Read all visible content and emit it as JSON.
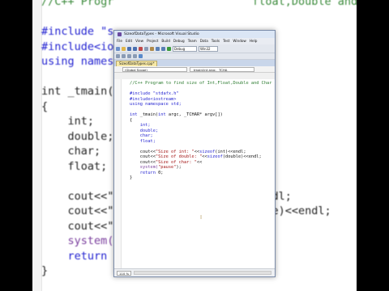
{
  "background_editor": {
    "lines": [
      {
        "parts": [
          {
            "t": "//C++ Progr",
            "c": "cm"
          },
          {
            "t": "                     ",
            "c": ""
          },
          {
            "t": "float,Double and cha",
            "c": "cm"
          }
        ]
      },
      {
        "parts": [
          {
            "t": "",
            "c": ""
          }
        ]
      },
      {
        "parts": [
          {
            "t": "#include \"s",
            "c": "kw"
          }
        ]
      },
      {
        "parts": [
          {
            "t": "#include<io",
            "c": "kw"
          }
        ]
      },
      {
        "parts": [
          {
            "t": "using names",
            "c": "kw"
          }
        ]
      },
      {
        "parts": [
          {
            "t": "",
            "c": ""
          }
        ]
      },
      {
        "parts": [
          {
            "t": "int _tmain(",
            "c": ""
          },
          {
            "t": "                     ",
            "c": ""
          },
          {
            "t": "[])",
            "c": ""
          }
        ]
      },
      {
        "parts": [
          {
            "t": "{",
            "c": ""
          }
        ]
      },
      {
        "parts": [
          {
            "t": "    int;",
            "c": ""
          }
        ]
      },
      {
        "parts": [
          {
            "t": "    double;",
            "c": ""
          }
        ]
      },
      {
        "parts": [
          {
            "t": "    char;",
            "c": ""
          }
        ]
      },
      {
        "parts": [
          {
            "t": "    float;",
            "c": ""
          }
        ]
      },
      {
        "parts": [
          {
            "t": "",
            "c": ""
          }
        ]
      },
      {
        "parts": [
          {
            "t": "    cout<<\"",
            "c": ""
          },
          {
            "t": "                  ",
            "c": ""
          },
          {
            "t": "t)<<endl;",
            "c": ""
          }
        ]
      },
      {
        "parts": [
          {
            "t": "    cout<<\"",
            "c": ""
          },
          {
            "t": "                  ",
            "c": ""
          },
          {
            "t": "(double)<<endl;",
            "c": ""
          }
        ]
      },
      {
        "parts": [
          {
            "t": "    cout<<\"",
            "c": ""
          }
        ]
      },
      {
        "parts": [
          {
            "t": "    system(",
            "c": "fn"
          }
        ]
      },
      {
        "parts": [
          {
            "t": "    return ",
            "c": "kw"
          }
        ]
      },
      {
        "parts": [
          {
            "t": "}",
            "c": ""
          }
        ]
      }
    ]
  },
  "window": {
    "title": "SizeofDataTypes - Microsoft Visual Studio",
    "menu": [
      "File",
      "Edit",
      "View",
      "Project",
      "Build",
      "Debug",
      "Team",
      "Data",
      "Tools",
      "Test",
      "Window",
      "Help"
    ],
    "config_select": "Debug",
    "platform_select": "Win32",
    "tab_label": "SizeofDataTypes.cpp*",
    "scope_select": "(Global Scope)",
    "function_select": "_tmain(int argc, _TCHA",
    "zoom_level": "110 %"
  },
  "code": [
    [
      {
        "t": "//C++ Program to find size of Int,Float,Double and Char",
        "c": "cm"
      }
    ],
    [
      {
        "t": "",
        "c": ""
      }
    ],
    [
      {
        "t": "#include \"stdafx.h\"",
        "c": "kw"
      }
    ],
    [
      {
        "t": "#include<iostream>",
        "c": "kw"
      }
    ],
    [
      {
        "t": "using namespace std;",
        "c": "kw"
      }
    ],
    [
      {
        "t": "",
        "c": ""
      }
    ],
    [
      {
        "t": "int",
        "c": "kw"
      },
      {
        "t": " _tmain(",
        "c": ""
      },
      {
        "t": "int",
        "c": "kw"
      },
      {
        "t": " argc, _TCHAR* argv[])",
        "c": ""
      }
    ],
    [
      {
        "t": "{",
        "c": ""
      }
    ],
    [
      {
        "t": "    int;",
        "c": "kw"
      }
    ],
    [
      {
        "t": "    double;",
        "c": "kw"
      }
    ],
    [
      {
        "t": "    char;",
        "c": "kw"
      }
    ],
    [
      {
        "t": "    float;",
        "c": "kw"
      }
    ],
    [
      {
        "t": "",
        "c": ""
      }
    ],
    [
      {
        "t": "    cout<<",
        "c": ""
      },
      {
        "t": "\"Size of int: \"",
        "c": "str"
      },
      {
        "t": "<<",
        "c": ""
      },
      {
        "t": "sizeof",
        "c": "kw"
      },
      {
        "t": "(int)<<endl;",
        "c": ""
      }
    ],
    [
      {
        "t": "    cout<<",
        "c": ""
      },
      {
        "t": "\"Size of double: \"",
        "c": "str"
      },
      {
        "t": "<<",
        "c": ""
      },
      {
        "t": "sizeof",
        "c": "kw"
      },
      {
        "t": "(double)<<endl;",
        "c": ""
      }
    ],
    [
      {
        "t": "    cout<<",
        "c": ""
      },
      {
        "t": "\"Size of char: \"",
        "c": "str"
      },
      {
        "t": "<<",
        "c": ""
      }
    ],
    [
      {
        "t": "    system(",
        "c": "fn"
      },
      {
        "t": "\"pause\"",
        "c": "str"
      },
      {
        "t": ");",
        "c": ""
      }
    ],
    [
      {
        "t": "    return",
        "c": "kw"
      },
      {
        "t": " 0;",
        "c": ""
      }
    ],
    [
      {
        "t": "}",
        "c": ""
      }
    ]
  ],
  "colors": {
    "keyword": "#1f1fd0",
    "string": "#a31515",
    "comment": "#2e7d32",
    "window_border": "#7a8ba8",
    "tab_active": "#f7e9a6"
  }
}
